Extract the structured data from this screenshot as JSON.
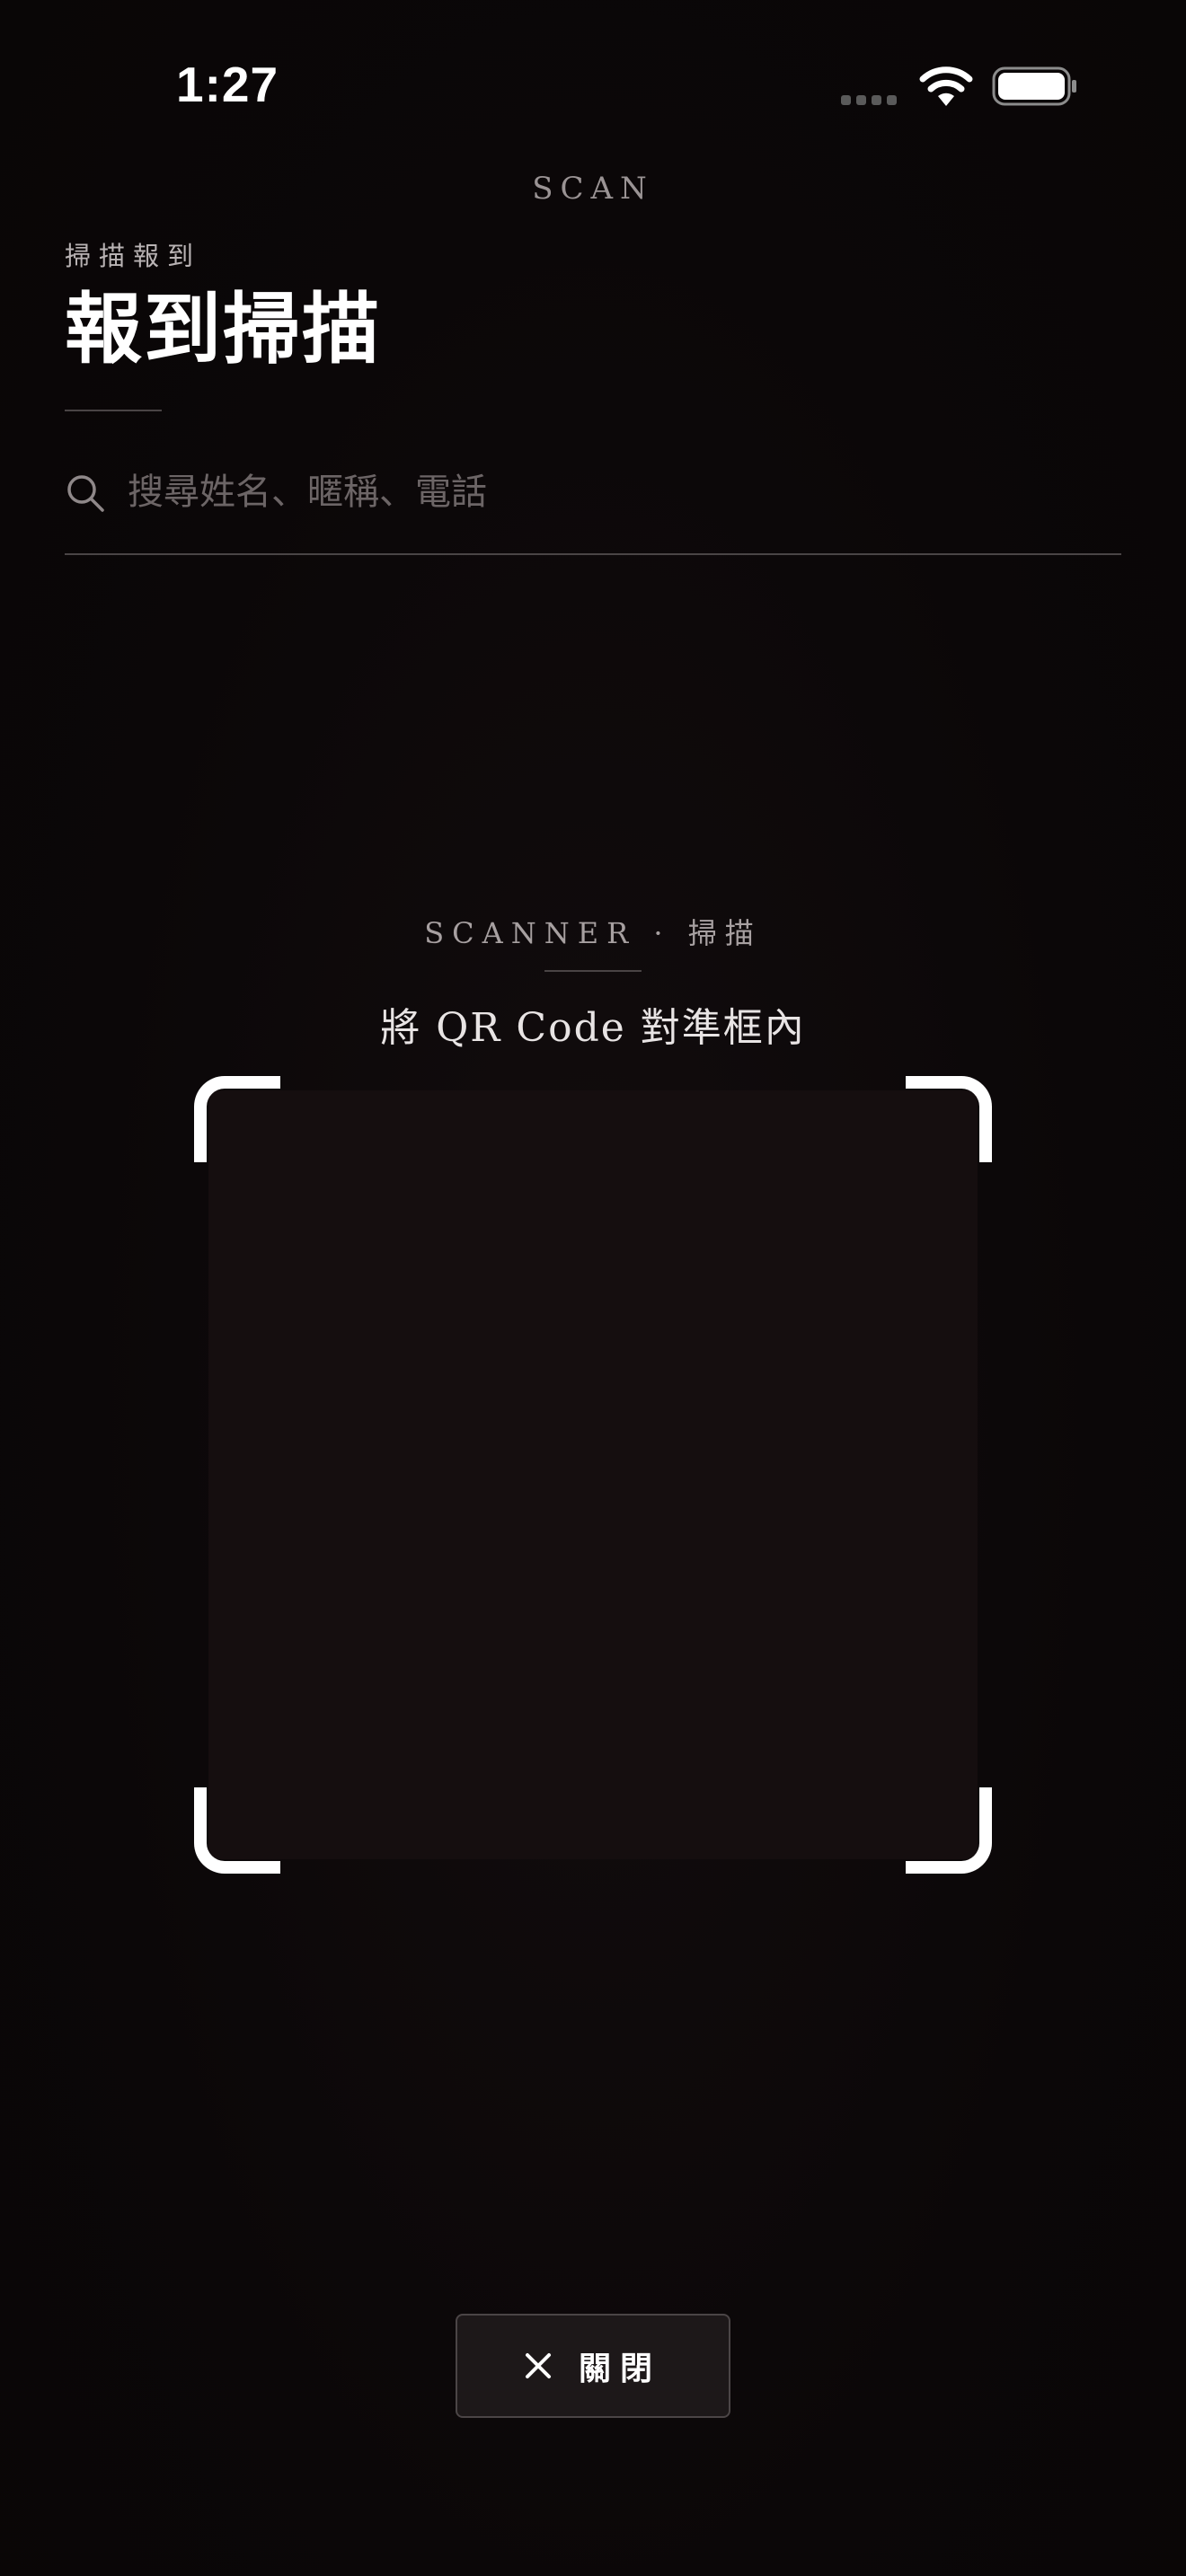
{
  "status_bar": {
    "time": "1:27",
    "icons": [
      "signal-icon",
      "wifi-icon",
      "battery-icon"
    ]
  },
  "header": {
    "overline": "SCAN",
    "subtitle": "掃描報到",
    "title": "報到掃描"
  },
  "search": {
    "placeholder": "搜尋姓名、暱稱、電話",
    "value": "",
    "icon": "search-icon"
  },
  "scanner": {
    "label": "SCANNER · 掃描",
    "instruction": "將 QR Code 對準框內"
  },
  "close_button": {
    "label": "關閉",
    "icon": "close-icon"
  },
  "colors": {
    "background": "#0b0708",
    "viewport": "#150e0f",
    "frame": "#ffffff",
    "button_bg": "#1d1819",
    "muted_text": "#9a9394"
  }
}
